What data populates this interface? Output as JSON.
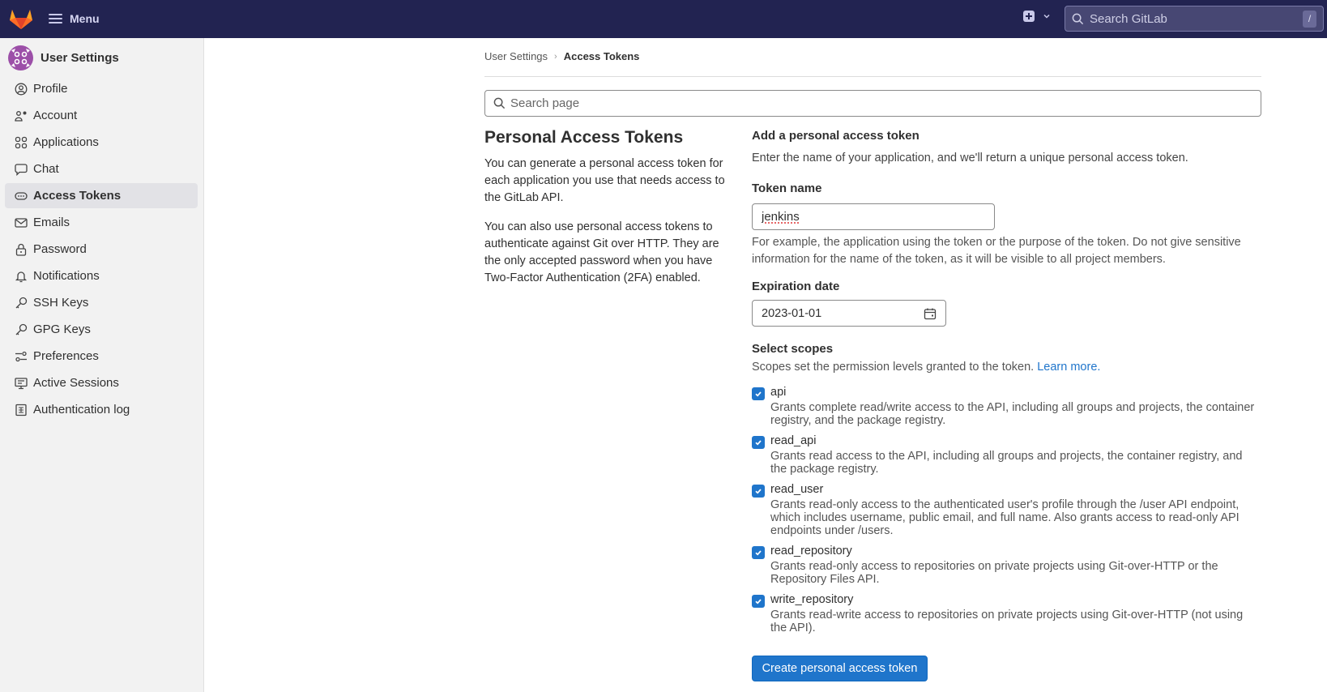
{
  "topbar": {
    "menu_label": "Menu",
    "search_placeholder": "Search GitLab",
    "search_shortcut": "/",
    "colors": {
      "background": "#222351",
      "logo_primary": "#e24329",
      "logo_secondary": "#fc6d26",
      "logo_tertiary": "#fca326"
    }
  },
  "sidebar": {
    "title": "User Settings",
    "items": [
      {
        "label": "Profile",
        "icon": "profile-icon",
        "active": false
      },
      {
        "label": "Account",
        "icon": "account-icon",
        "active": false
      },
      {
        "label": "Applications",
        "icon": "applications-icon",
        "active": false
      },
      {
        "label": "Chat",
        "icon": "chat-icon",
        "active": false
      },
      {
        "label": "Access Tokens",
        "icon": "token-icon",
        "active": true
      },
      {
        "label": "Emails",
        "icon": "mail-icon",
        "active": false
      },
      {
        "label": "Password",
        "icon": "lock-icon",
        "active": false
      },
      {
        "label": "Notifications",
        "icon": "bell-icon",
        "active": false
      },
      {
        "label": "SSH Keys",
        "icon": "key-icon",
        "active": false
      },
      {
        "label": "GPG Keys",
        "icon": "key-icon",
        "active": false
      },
      {
        "label": "Preferences",
        "icon": "preferences-icon",
        "active": false
      },
      {
        "label": "Active Sessions",
        "icon": "monitor-icon",
        "active": false
      },
      {
        "label": "Authentication log",
        "icon": "log-icon",
        "active": false
      }
    ]
  },
  "breadcrumb": {
    "parent": "User Settings",
    "current": "Access Tokens"
  },
  "page_search": {
    "placeholder": "Search page",
    "value": ""
  },
  "intro": {
    "title": "Personal Access Tokens",
    "paragraph_1": "You can generate a personal access token for each application you use that needs access to the GitLab API.",
    "paragraph_2": "You can also use personal access tokens to authenticate against Git over HTTP. They are the only accepted password when you have Two-Factor Authentication (2FA) enabled."
  },
  "form": {
    "heading": "Add a personal access token",
    "description": "Enter the name of your application, and we'll return a unique personal access token.",
    "token_name": {
      "label": "Token name",
      "value": "jenkins",
      "help": "For example, the application using the token or the purpose of the token. Do not give sensitive information for the name of the token, as it will be visible to all project members."
    },
    "expiration": {
      "label": "Expiration date",
      "value": "2023-01-01"
    },
    "scopes": {
      "label": "Select scopes",
      "description": "Scopes set the permission levels granted to the token.",
      "learn_more": "Learn more.",
      "items": [
        {
          "name": "api",
          "checked": true,
          "description": "Grants complete read/write access to the API, including all groups and projects, the container registry, and the package registry."
        },
        {
          "name": "read_api",
          "checked": true,
          "description": "Grants read access to the API, including all groups and projects, the container registry, and the package registry."
        },
        {
          "name": "read_user",
          "checked": true,
          "description": "Grants read-only access to the authenticated user's profile through the /user API endpoint, which includes username, public email, and full name. Also grants access to read-only API endpoints under /users."
        },
        {
          "name": "read_repository",
          "checked": true,
          "description": "Grants read-only access to repositories on private projects using Git-over-HTTP or the Repository Files API."
        },
        {
          "name": "write_repository",
          "checked": true,
          "description": "Grants read-write access to repositories on private projects using Git-over-HTTP (not using the API)."
        }
      ]
    },
    "submit_label": "Create personal access token",
    "accent_color": "#1f75cb"
  }
}
